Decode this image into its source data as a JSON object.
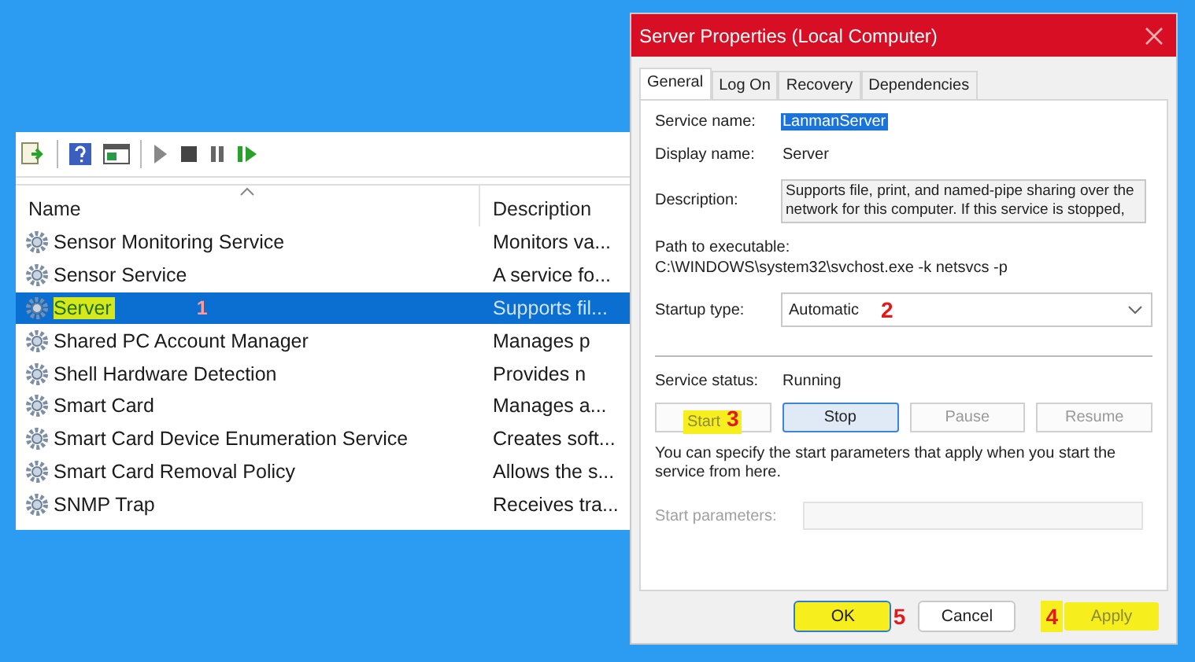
{
  "services_window": {
    "columns": [
      "Name",
      "Description"
    ],
    "rows": [
      {
        "name": "Sensor Monitoring Service",
        "description": "Monitors va...",
        "selected": false,
        "highlighted": false
      },
      {
        "name": "Sensor Service",
        "description": "A service fo...",
        "selected": false,
        "highlighted": false
      },
      {
        "name": "Server",
        "description": "Supports fil...",
        "selected": true,
        "highlighted": true,
        "annotation": "1"
      },
      {
        "name": "Shared PC Account Manager",
        "description": "Manages p",
        "selected": false,
        "highlighted": false
      },
      {
        "name": "Shell Hardware Detection",
        "description": "Provides n",
        "selected": false,
        "highlighted": false
      },
      {
        "name": "Smart Card",
        "description": "Manages a...",
        "selected": false,
        "highlighted": false
      },
      {
        "name": "Smart Card Device Enumeration Service",
        "description": "Creates soft...",
        "selected": false,
        "highlighted": false
      },
      {
        "name": "Smart Card Removal Policy",
        "description": "Allows the s...",
        "selected": false,
        "highlighted": false
      },
      {
        "name": "SNMP Trap",
        "description": "Receives tra...",
        "selected": false,
        "highlighted": false
      }
    ]
  },
  "dialog": {
    "title": "Server Properties (Local Computer)",
    "tabs": [
      {
        "label": "General",
        "selected": true
      },
      {
        "label": "Log On",
        "selected": false
      },
      {
        "label": "Recovery",
        "selected": false
      },
      {
        "label": "Dependencies",
        "selected": false
      }
    ],
    "service_name": {
      "label": "Service name:",
      "value": "LanmanServer"
    },
    "display_name": {
      "label": "Display name:",
      "value": "Server"
    },
    "description": {
      "label": "Description:",
      "value": "Supports file, print, and named-pipe sharing over the network for this computer. If this service is stopped,"
    },
    "path": {
      "label": "Path to executable:",
      "value": "C:\\WINDOWS\\system32\\svchost.exe -k netsvcs -p"
    },
    "startup_type": {
      "label": "Startup type:",
      "value": "Automatic",
      "annotation": "2"
    },
    "service_status": {
      "label": "Service status:",
      "value": "Running"
    },
    "control_buttons": [
      {
        "label": "Start",
        "disabled": true,
        "focused": false,
        "highlighted": true,
        "annotation": "3"
      },
      {
        "label": "Stop",
        "disabled": false,
        "focused": true,
        "highlighted": false
      },
      {
        "label": "Pause",
        "disabled": true,
        "focused": false,
        "highlighted": false
      },
      {
        "label": "Resume",
        "disabled": true,
        "focused": false,
        "highlighted": false
      }
    ],
    "hint": "You can specify the start parameters that apply when you start the service from here.",
    "start_parameters": {
      "label": "Start parameters:",
      "disabled": true
    },
    "footer": [
      {
        "kind": "button",
        "label": "OK",
        "disabled": false,
        "focused": true,
        "highlighted": true
      },
      {
        "kind": "step_number",
        "text": "5",
        "highlighted": false
      },
      {
        "kind": "button",
        "label": "Cancel",
        "disabled": false,
        "focused": false,
        "highlighted": false
      },
      {
        "kind": "step_number",
        "text": "4",
        "highlighted": true
      },
      {
        "kind": "button",
        "label": "Apply",
        "disabled": true,
        "focused": false,
        "highlighted": true
      }
    ]
  }
}
